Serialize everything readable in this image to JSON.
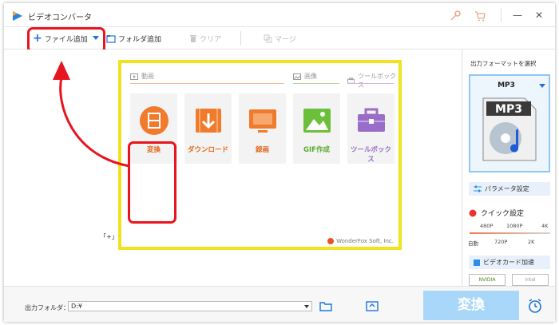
{
  "app": {
    "title": "ビデオコンバータ"
  },
  "toolbar": {
    "add_file": "ファイル追加",
    "add_folder": "フォルダ追加",
    "clear": "クリア",
    "merge": "マージ"
  },
  "launcher": {
    "categories": {
      "video": "動画",
      "image": "画像",
      "toolbox": "ツールボックス"
    },
    "cards": [
      {
        "label": "変換",
        "icon": "film-icon",
        "color": "#f07b2c"
      },
      {
        "label": "ダウンロード",
        "icon": "download-icon",
        "color": "#f07b2c"
      },
      {
        "label": "録画",
        "icon": "screen-record-icon",
        "color": "#f07b2c"
      },
      {
        "label": "GIF作成",
        "icon": "image-icon",
        "color": "#6cbf3a"
      },
      {
        "label": "ツールボックス",
        "icon": "toolbox-icon",
        "color": "#9a6ec8"
      }
    ],
    "brand": "WonderFox Soft, Inc."
  },
  "main": {
    "hint_fragment": "「+」す"
  },
  "right_panel": {
    "title": "出力フォーマットを選択",
    "format": "MP3",
    "format_badge": "MP3",
    "params": "パラメータ設定",
    "quick": "クイック設定",
    "slider_top": [
      "480P",
      "1080P",
      "4K"
    ],
    "slider_bottom": [
      "自動",
      "720P",
      "2K"
    ],
    "gpu": "ビデオカード加速",
    "nvidia": "NVIDIA",
    "intel": "intel"
  },
  "bottom": {
    "output_label": "出力フォルダ：",
    "output_path": "D:¥",
    "run": "変換"
  },
  "colors": {
    "accent": "#1e73d9",
    "highlight_red": "#e8141e",
    "frame_yellow": "#f0e21c",
    "run_button": "#a9d7f9"
  }
}
